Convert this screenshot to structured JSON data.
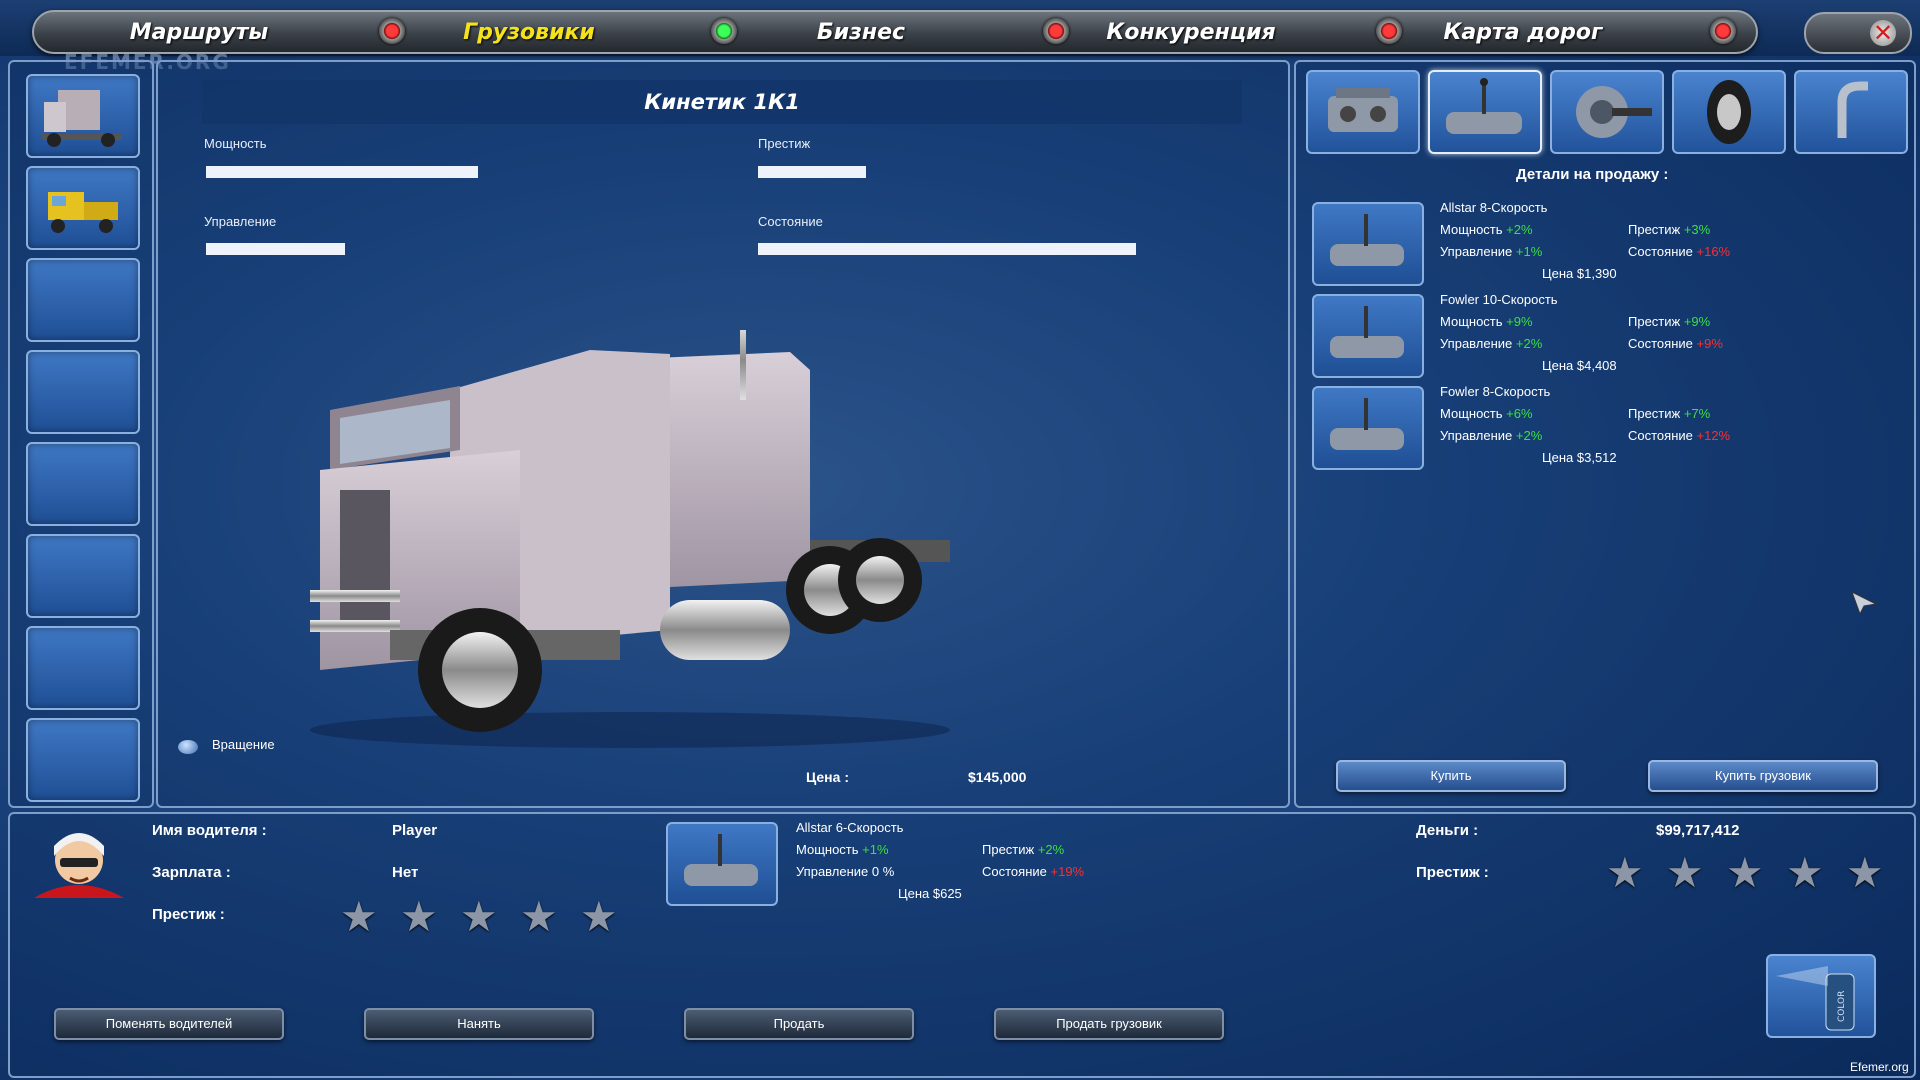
{
  "watermark": "EFEMER.ORG",
  "footer_watermark": "Efemer.org",
  "nav": {
    "tabs": [
      {
        "label": "Маршруты"
      },
      {
        "label": "Грузовики"
      },
      {
        "label": "Бизнес"
      },
      {
        "label": "Конкуренция"
      },
      {
        "label": "Карта дорог"
      }
    ],
    "active": "Грузовики"
  },
  "truck": {
    "name": "Кинетик 1К1",
    "stats": {
      "power_label": "Мощность",
      "power": 0.51,
      "prestige_label": "Престиж",
      "prestige": 0.2,
      "handling_label": "Управление",
      "handling": 0.26,
      "condition_label": "Состояние",
      "condition": 0.7
    },
    "rotate_label": "Вращение",
    "price_label": "Цена :",
    "price": "$145,000"
  },
  "parts": {
    "heading": "Детали на продажу :",
    "categories": [
      "engine-icon",
      "transmission-icon",
      "chassis-icon",
      "tire-icon",
      "exhaust-icon"
    ],
    "active_category": "transmission-icon",
    "items": [
      {
        "name": "Allstar 8-Скорость",
        "power_label": "Мощность",
        "power": "+2%",
        "prestige_label": "Престиж",
        "prestige": "+3%",
        "handling_label": "Управление",
        "handling": "+1%",
        "condition_label": "Состояние",
        "condition": "+16%",
        "price": "Цена $1,390"
      },
      {
        "name": "Fowler 10-Скорость",
        "power_label": "Мощность",
        "power": "+9%",
        "prestige_label": "Престиж",
        "prestige": "+9%",
        "handling_label": "Управление",
        "handling": "+2%",
        "condition_label": "Состояние",
        "condition": "+9%",
        "price": "Цена $4,408"
      },
      {
        "name": "Fowler 8-Скорость",
        "power_label": "Мощность",
        "power": "+6%",
        "prestige_label": "Престиж",
        "prestige": "+7%",
        "handling_label": "Управление",
        "handling": "+2%",
        "condition_label": "Состояние",
        "condition": "+12%",
        "price": "Цена $3,512"
      }
    ],
    "buy_label": "Купить",
    "buy_truck_label": "Купить грузовик"
  },
  "driver": {
    "name_label": "Имя водителя :",
    "name": "Player",
    "salary_label": "Зарплата :",
    "salary": "Нет",
    "prestige_label": "Престиж :",
    "prestige_stars": 0
  },
  "installed_part": {
    "name": "Allstar 6-Скорость",
    "power_label": "Мощность",
    "power": "+1%",
    "prestige_label": "Престиж",
    "prestige": "+2%",
    "handling_label": "Управление",
    "handling": "0 %",
    "condition_label": "Состояние",
    "condition": "+19%",
    "price": "Цена $625"
  },
  "company": {
    "money_label": "Деньги :",
    "money": "$99,717,412",
    "prestige_label": "Престиж :",
    "prestige_stars": 0
  },
  "actions": {
    "change_driver": "Поменять водителей",
    "hire": "Нанять",
    "sell": "Продать",
    "sell_truck": "Продать грузовик"
  },
  "paint_icon_text": "COLOR"
}
